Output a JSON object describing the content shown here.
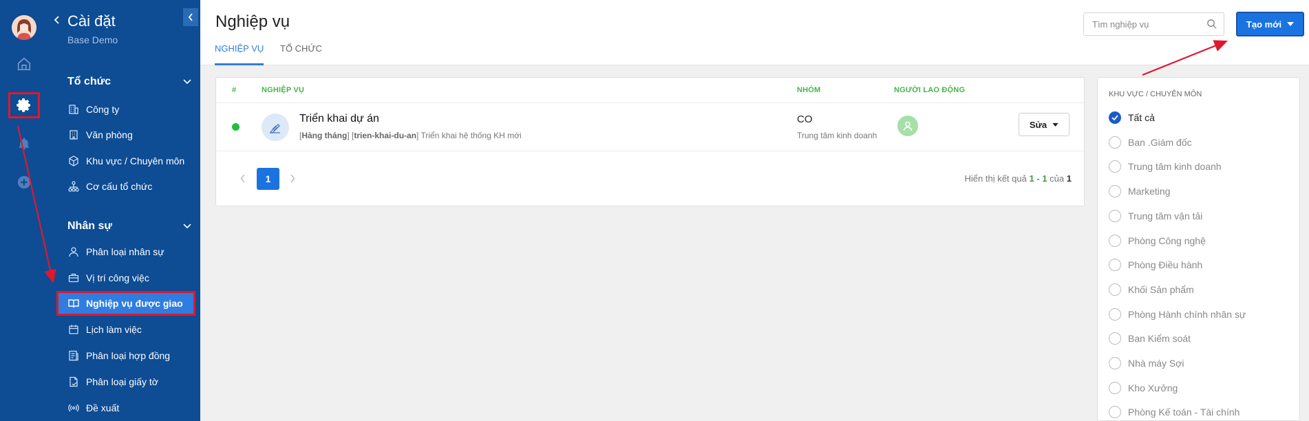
{
  "app": {
    "title": "Cài đặt",
    "subtitle": "Base Demo"
  },
  "sidebar": {
    "sections": [
      {
        "label": "Tổ chức",
        "items": [
          {
            "label": "Công ty",
            "icon": "building-icon"
          },
          {
            "label": "Văn phòng",
            "icon": "office-icon"
          },
          {
            "label": "Khu vực / Chuyên môn",
            "icon": "cube-icon"
          },
          {
            "label": "Cơ cấu tổ chức",
            "icon": "org-chart-icon"
          }
        ]
      },
      {
        "label": "Nhân sự",
        "items": [
          {
            "label": "Phân loại nhân sự",
            "icon": "user-icon"
          },
          {
            "label": "Vị trí công việc",
            "icon": "briefcase-icon"
          },
          {
            "label": "Nghiệp vụ được giao",
            "icon": "book-icon"
          },
          {
            "label": "Lịch làm việc",
            "icon": "calendar-icon"
          },
          {
            "label": "Phân loại hợp đồng",
            "icon": "contract-icon"
          },
          {
            "label": "Phân loại giấy tờ",
            "icon": "document-icon"
          },
          {
            "label": "Đề xuất",
            "icon": "broadcast-icon"
          }
        ]
      }
    ]
  },
  "header": {
    "title": "Nghiệp vụ",
    "tabs": [
      {
        "label": "NGHIỆP VỤ",
        "active": true
      },
      {
        "label": "TỔ CHỨC",
        "active": false
      }
    ],
    "search_placeholder": "Tìm nghiệp vụ",
    "create_label": "Tạo mới"
  },
  "table": {
    "columns": [
      "#",
      "NGHIỆP VỤ",
      "NHÓM",
      "NGƯỜI LAO ĐỘNG"
    ],
    "rows": [
      {
        "name": "Triển khai dự án",
        "freq": "Hàng tháng",
        "code": "trien-khai-du-an",
        "desc": "Triển khai hệ thống KH mới",
        "group": "CO",
        "group_sub": "Trung tâm kinh doanh",
        "edit_label": "Sửa"
      }
    ]
  },
  "pagination": {
    "current": "1",
    "info_prefix": "Hiển thị kết quả",
    "from": "1",
    "dash": "-",
    "to": "1",
    "of_word": "của",
    "total": "1"
  },
  "filter": {
    "title": "KHU VỰC / CHUYÊN MÔN",
    "options": [
      {
        "label": "Tất cả",
        "checked": true
      },
      {
        "label": "Ban .Giám đốc",
        "checked": false
      },
      {
        "label": "Trung tâm kinh doanh",
        "checked": false
      },
      {
        "label": "Marketing",
        "checked": false
      },
      {
        "label": "Trung tâm vận tải",
        "checked": false
      },
      {
        "label": "Phòng Công nghệ",
        "checked": false
      },
      {
        "label": "Phòng Điều hành",
        "checked": false
      },
      {
        "label": "Khối Sản phẩm",
        "checked": false
      },
      {
        "label": "Phòng Hành chính nhân sự",
        "checked": false
      },
      {
        "label": "Ban Kiểm soát",
        "checked": false
      },
      {
        "label": "Nhà máy Sợi",
        "checked": false
      },
      {
        "label": "Kho Xưởng",
        "checked": false
      },
      {
        "label": "Phòng Kế toán - Tài chính",
        "checked": false
      }
    ]
  },
  "colors": {
    "sidebar_bg": "#0e4c94",
    "accent": "#1a73e0",
    "header_green": "#46b44a",
    "annotation_red": "#e0182d"
  }
}
